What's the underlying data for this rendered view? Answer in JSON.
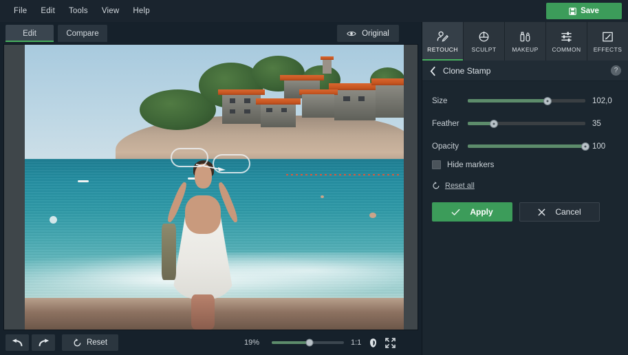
{
  "menu": {
    "items": [
      {
        "label": "File"
      },
      {
        "label": "Edit"
      },
      {
        "label": "Tools"
      },
      {
        "label": "View"
      },
      {
        "label": "Help"
      }
    ],
    "save_label": "Save",
    "save_icon": "floppy-disk-icon",
    "save_color": "#3c9c5a"
  },
  "modes": {
    "edit_label": "Edit",
    "compare_label": "Compare",
    "active": "Edit",
    "original_label": "Original",
    "original_icon": "eye-icon"
  },
  "canvas": {
    "photo_alt": "Seaside town with orange-roofed stone houses on a rocky island and a woman in a white dress standing in the surf",
    "markers": [
      {
        "name": "clone-source-marker"
      },
      {
        "name": "clone-target-marker"
      },
      {
        "name": "clone-direction-arrow"
      },
      {
        "name": "brush-cursor"
      }
    ]
  },
  "bottom": {
    "undo_icon": "undo-arrow-icon",
    "redo_icon": "redo-arrow-icon",
    "reset_label": "Reset",
    "reset_icon": "reset-circular-arrow-icon",
    "zoom_percent": "19%",
    "zoom_slider_value": 52,
    "ratio_label": "1:1",
    "face_icon": "face-fit-icon",
    "fullscreen_icon": "expand-arrows-icon"
  },
  "right_panel": {
    "categories": [
      {
        "label": "RETOUCH",
        "icon": "person-pencil-icon",
        "active": true
      },
      {
        "label": "SCULPT",
        "icon": "crosshair-circle-icon",
        "active": false
      },
      {
        "label": "MAKEUP",
        "icon": "lipstick-brush-icon",
        "active": false
      },
      {
        "label": "COMMON",
        "icon": "sliders-icon",
        "active": false
      },
      {
        "label": "EFFECTS",
        "icon": "magic-wand-frame-icon",
        "active": false
      }
    ],
    "active_tool": "Clone Stamp",
    "back_icon": "back-chevron-icon",
    "help_icon": "help-question-icon",
    "help_label": "?",
    "sliders": [
      {
        "label": "Size",
        "value": "102,0",
        "percent": 68
      },
      {
        "label": "Feather",
        "value": "35",
        "percent": 22
      },
      {
        "label": "Opacity",
        "value": "100",
        "percent": 100
      }
    ],
    "hide_markers_label": "Hide markers",
    "hide_markers_checked": false,
    "reset_all_label": "Reset all",
    "reset_all_icon": "reset-circular-arrow-icon",
    "apply_label": "Apply",
    "apply_icon": "check-icon",
    "cancel_label": "Cancel",
    "cancel_icon": "x-icon",
    "accent_color": "#48b05f"
  }
}
